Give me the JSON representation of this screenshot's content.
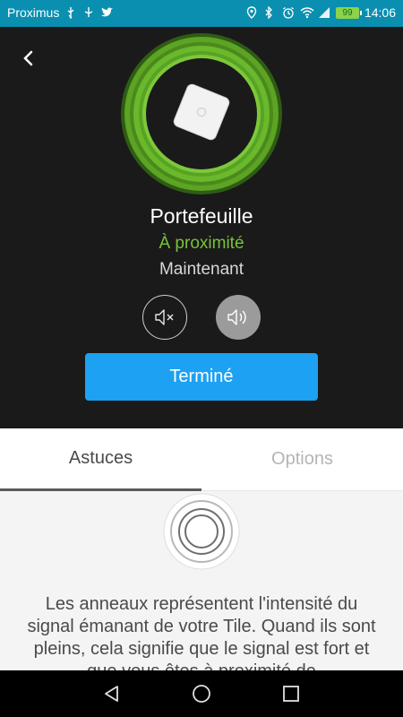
{
  "status_bar": {
    "carrier": "Proximus",
    "battery": "99",
    "time": "14:06"
  },
  "tile": {
    "name": "Portefeuille",
    "status": "À proximité",
    "last_seen": "Maintenant"
  },
  "actions": {
    "done_label": "Terminé"
  },
  "tabs": [
    {
      "label": "Astuces",
      "selected": true
    },
    {
      "label": "Options",
      "selected": false
    }
  ],
  "tips": {
    "text": "Les anneaux représentent l'intensité du signal émanant de votre Tile. Quand ils sont pleins, cela signifie que le signal est fort et que vous êtes à proximité de"
  },
  "colors": {
    "status_bar": "#0a8fb0",
    "accent_green": "#78c23a",
    "button_blue": "#1da1f2"
  }
}
